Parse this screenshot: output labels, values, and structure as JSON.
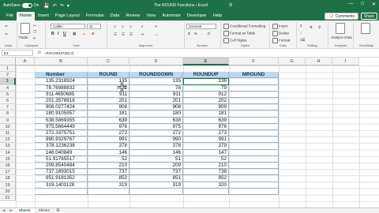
{
  "titlebar": {
    "autosave_label": "AutoSave",
    "autosave_state": "On",
    "doc_title": "The ROUND Functions • Excel",
    "search_placeholder": "Search"
  },
  "tabs": [
    "File",
    "Home",
    "Insert",
    "Page Layout",
    "Formulas",
    "Data",
    "Review",
    "View",
    "Automate",
    "Developer",
    "Help"
  ],
  "active_tab": "Home",
  "comments_label": "Comments",
  "share_label": "Share",
  "ribbon": {
    "clipboard": {
      "paste": "Paste",
      "label": "Clipboard"
    },
    "font": {
      "name": "Calibri",
      "size": "11",
      "label": "Font"
    },
    "alignment": {
      "label": "Alignment"
    },
    "number": {
      "format": "General",
      "label": "Number"
    },
    "styles": {
      "conditional": "Conditional Formatting",
      "table": "Format as Table",
      "cell": "Cell Styles",
      "label": "Styles"
    },
    "cells": {
      "insert": "Insert",
      "delete": "Delete",
      "format": "Format",
      "label": "Cells"
    },
    "editing": {
      "label": "Editing"
    },
    "analysis": {
      "analyze": "Analyze Data",
      "label": "Analysis"
    },
    "sensitivity": {
      "label": "Sensitivity"
    },
    "undo_label": "Undo"
  },
  "formula_bar": {
    "name_box": "E3",
    "formula": "=ROUNDUP(B3,0)"
  },
  "columns": [
    "A",
    "B",
    "C",
    "D",
    "E",
    "F",
    "G",
    "H",
    "I"
  ],
  "rows": [
    "1",
    "2",
    "3",
    "4",
    "5",
    "6",
    "7",
    "8",
    "9",
    "10",
    "11",
    "12",
    "13",
    "14",
    "15",
    "16",
    "17",
    "18",
    "19",
    "20",
    "21"
  ],
  "table": {
    "headers": [
      "Number",
      "ROUND",
      "ROUNDDOWN",
      "ROUNDUP",
      "MROUND"
    ],
    "rows": [
      [
        "135.2318924",
        "135",
        "135",
        "136",
        ""
      ],
      [
        "78.76988832",
        "79",
        "78",
        "79",
        ""
      ],
      [
        "911.4650685",
        "911",
        "911",
        "912",
        ""
      ],
      [
        "201.3578918",
        "201",
        "201",
        "202",
        ""
      ],
      [
        "908.0277424",
        "908",
        "908",
        "909",
        ""
      ],
      [
        "180.9105957",
        "181",
        "180",
        "181",
        ""
      ],
      [
        "638.5869355",
        "639",
        "638",
        "639",
        ""
      ],
      [
        "975.5664449",
        "976",
        "975",
        "976",
        ""
      ],
      [
        "272.3375751",
        "272",
        "272",
        "273",
        ""
      ],
      [
        "990.9329767",
        "991",
        "990",
        "991",
        ""
      ],
      [
        "378.1236238",
        "378",
        "378",
        "379",
        ""
      ],
      [
        "146.040849",
        "146",
        "146",
        "147",
        ""
      ],
      [
        "51.91765517",
        "52",
        "51",
        "52",
        ""
      ],
      [
        "209.8540484",
        "210",
        "209",
        "210",
        ""
      ],
      [
        "737.1893015",
        "737",
        "737",
        "738",
        ""
      ],
      [
        "851.9181352",
        "852",
        "851",
        "852",
        ""
      ],
      [
        "319.1401128",
        "319",
        "319",
        "320",
        ""
      ],
      [
        "",
        "",
        "",
        "",
        ""
      ]
    ]
  },
  "sheets": [
    "Sheet1",
    "Sheet2"
  ],
  "active_sheet": "Sheet1",
  "colors": {
    "accent": "#1e7145",
    "header_fill": "#bdd7ee",
    "table_border": "#9cb3c9"
  }
}
